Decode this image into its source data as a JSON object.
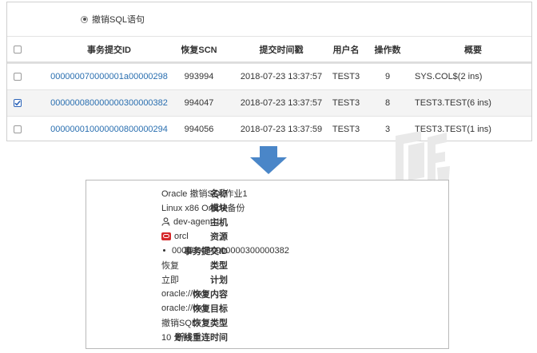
{
  "radio_option": {
    "label": "撤销SQL语句",
    "selected": true
  },
  "table": {
    "columns": [
      "",
      "事务提交ID",
      "恢复SCN",
      "提交时间戳",
      "用户名",
      "操作数",
      "概要"
    ],
    "rows": [
      {
        "checked": false,
        "txid": "000000070000001a00000298",
        "scn": "993994",
        "time": "2018-07-23 13:37:57",
        "user": "TEST3",
        "ops": "9",
        "summary": "SYS.COL$(2 ins)"
      },
      {
        "checked": true,
        "txid": "000000080000000300000382",
        "scn": "994047",
        "time": "2018-07-23 13:37:57",
        "user": "TEST3",
        "ops": "8",
        "summary": "TEST3.TEST(6 ins)"
      },
      {
        "checked": false,
        "txid": "000000010000000800000294",
        "scn": "994056",
        "time": "2018-07-23 13:37:59",
        "user": "TEST3",
        "ops": "3",
        "summary": "TEST3.TEST(1 ins)"
      }
    ]
  },
  "colors": {
    "link": "#2a6fb0",
    "arrow": "#4a86c8",
    "orcl_badge": "#d6282b",
    "checkbox_checked": "#2b63b8"
  },
  "detail": {
    "rows": [
      {
        "label": "名称",
        "value": "Oracle 撤销SQL作业1"
      },
      {
        "label": "模块",
        "value": "Linux x86 Oracle备份"
      },
      {
        "label": "主机",
        "value": "dev-agent-1",
        "icon": "agent-icon"
      },
      {
        "label": "资源",
        "value": "orcl",
        "icon": "oracle-db-icon"
      },
      {
        "label": "事务提交ID",
        "value": "000000080000000300000382",
        "icon": "bullet"
      },
      {
        "label": "类型",
        "value": "恢复"
      },
      {
        "label": "计划",
        "value": "立即"
      },
      {
        "label": "恢复内容",
        "value": "oracle://orcl"
      },
      {
        "label": "恢复目标",
        "value": "oracle://orcl"
      },
      {
        "label": "恢复类型",
        "value": "撤销SQL"
      },
      {
        "label": "断线重连时间",
        "value": "10 分钟"
      }
    ]
  }
}
